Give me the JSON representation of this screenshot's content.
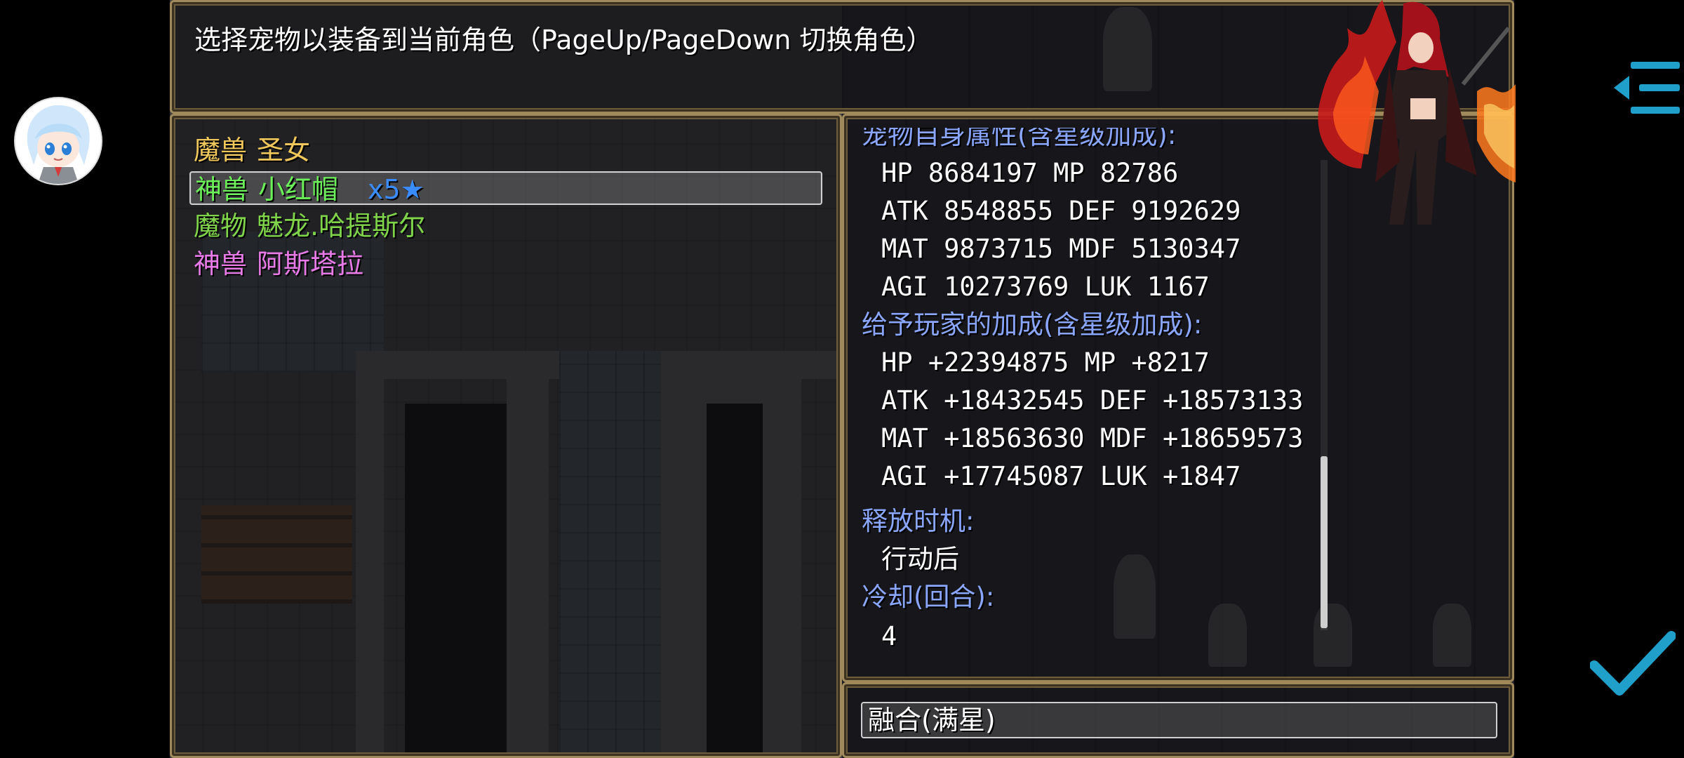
{
  "help": {
    "text": "选择宠物以装备到当前角色（PageUp/PageDown 切换角色）"
  },
  "pet_list": [
    {
      "type": "魔兽",
      "name": "圣女",
      "stars": "",
      "color": "#f0c75a",
      "selected": false
    },
    {
      "type": "神兽",
      "name": "小红帽",
      "stars": "x5★",
      "color": "#6cf05a",
      "selected": true
    },
    {
      "type": "魔物",
      "name": "魅龙.哈提斯尔",
      "stars": "",
      "color": "#7fd44a",
      "selected": false
    },
    {
      "type": "神兽",
      "name": "阿斯塔拉",
      "stars": "",
      "color": "#e87ae8",
      "selected": false
    }
  ],
  "detail": {
    "self_stats_header": "宠物自身属性(含星级加成):",
    "self_stats": [
      "HP 8684197  MP 82786",
      "ATK 8548855  DEF 9192629",
      "MAT 9873715  MDF 5130347",
      "AGI 10273769  LUK 1167"
    ],
    "bonus_header": "给予玩家的加成(含星级加成):",
    "bonus_stats": [
      "HP +22394875  MP +8217",
      "ATK +18432545  DEF +18573133",
      "MAT +18563630  MDF +18659573",
      "AGI +17745087  LUK +1847"
    ],
    "release_header": "释放时机:",
    "release_value": "行动后",
    "cooldown_header": "冷却(回合):",
    "cooldown_value": "4"
  },
  "command": {
    "fuse_label": "融合(满星)"
  },
  "scroll": {
    "position_fraction": 0.63
  },
  "icons": {
    "avatar": "chibi-girl-avatar",
    "menu": "menu-collapse-icon",
    "confirm": "checkmark-icon"
  },
  "colors": {
    "header_blue": "#8aa6ff",
    "accent_teal": "#1f9fc9"
  }
}
